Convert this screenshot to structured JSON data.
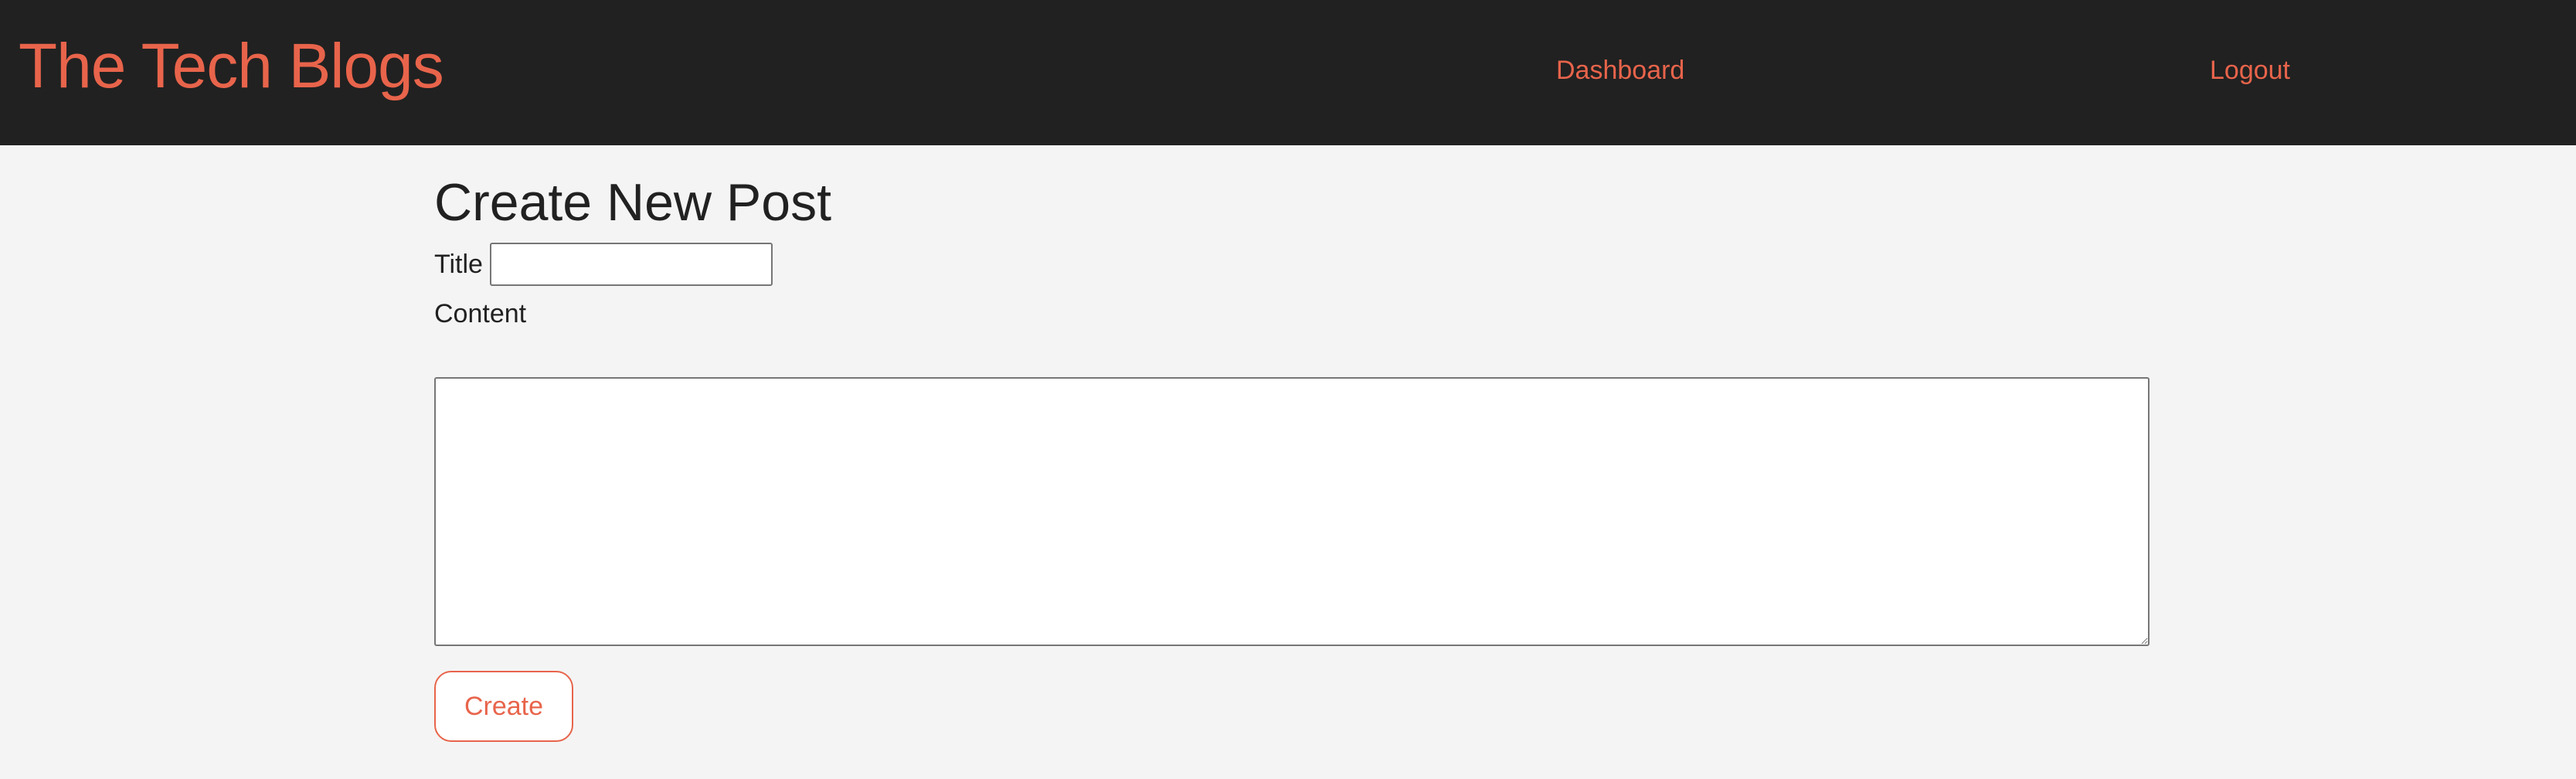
{
  "header": {
    "brand": "The Tech Blogs",
    "nav": {
      "dashboard": "Dashboard",
      "logout": "Logout"
    }
  },
  "form": {
    "heading": "Create New Post",
    "title_label": "Title",
    "title_value": "",
    "content_label": "Content",
    "content_value": "",
    "submit_label": "Create"
  },
  "colors": {
    "accent": "#e8644b",
    "header_bg": "#212121",
    "page_bg": "#f4f4f4",
    "text": "#212121"
  }
}
